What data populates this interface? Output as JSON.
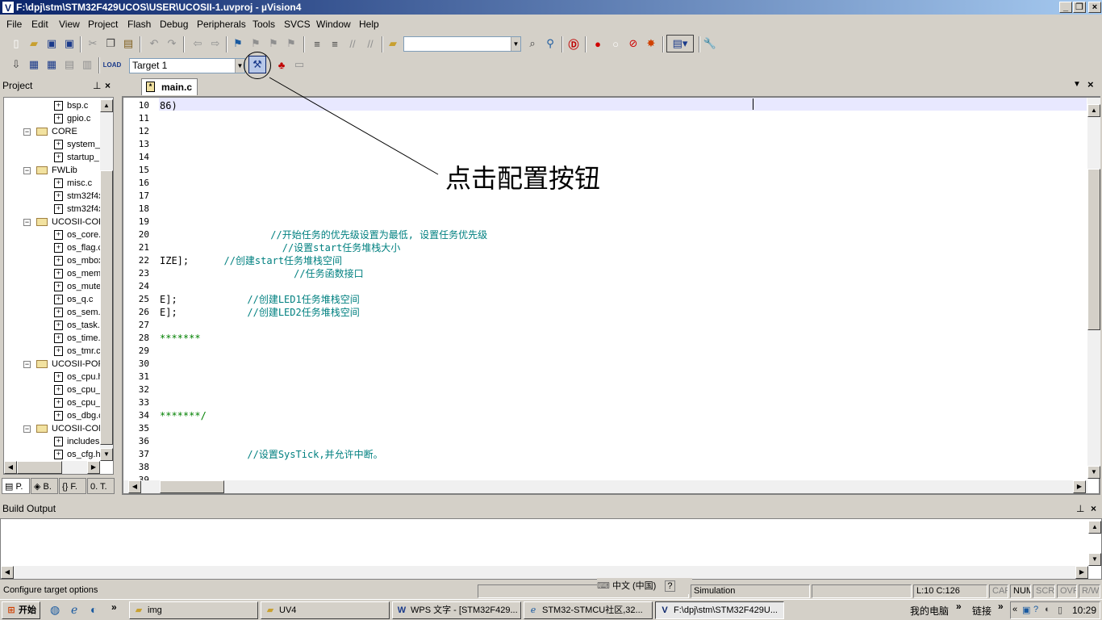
{
  "window": {
    "title": "F:\\dpj\\stm\\STM32F429UCOS\\USER\\UCOSII-1.uvproj - µVision4"
  },
  "menu": [
    "File",
    "Edit",
    "View",
    "Project",
    "Flash",
    "Debug",
    "Peripherals",
    "Tools",
    "SVCS",
    "Window",
    "Help"
  ],
  "toolbar": {
    "target": "Target 1",
    "find_value": ""
  },
  "project": {
    "header": "Project",
    "tree": [
      {
        "type": "file",
        "label": "bsp.c",
        "indent": 2
      },
      {
        "type": "file",
        "label": "gpio.c",
        "indent": 2
      },
      {
        "type": "folder",
        "label": "CORE",
        "indent": 1
      },
      {
        "type": "file",
        "label": "system_s",
        "indent": 2
      },
      {
        "type": "file",
        "label": "startup_",
        "indent": 2
      },
      {
        "type": "folder",
        "label": "FWLib",
        "indent": 1
      },
      {
        "type": "file",
        "label": "misc.c",
        "indent": 2
      },
      {
        "type": "file",
        "label": "stm32f4x",
        "indent": 2
      },
      {
        "type": "file",
        "label": "stm32f4x",
        "indent": 2
      },
      {
        "type": "folder",
        "label": "UCOSII-COR",
        "indent": 1
      },
      {
        "type": "file",
        "label": "os_core.",
        "indent": 2
      },
      {
        "type": "file",
        "label": "os_flag.c",
        "indent": 2
      },
      {
        "type": "file",
        "label": "os_mbox",
        "indent": 2
      },
      {
        "type": "file",
        "label": "os_mem.",
        "indent": 2
      },
      {
        "type": "file",
        "label": "os_mute",
        "indent": 2
      },
      {
        "type": "file",
        "label": "os_q.c",
        "indent": 2
      },
      {
        "type": "file",
        "label": "os_sem.c",
        "indent": 2
      },
      {
        "type": "file",
        "label": "os_task.",
        "indent": 2
      },
      {
        "type": "file",
        "label": "os_time.",
        "indent": 2
      },
      {
        "type": "file",
        "label": "os_tmr.c",
        "indent": 2
      },
      {
        "type": "folder",
        "label": "UCOSII-POR",
        "indent": 1
      },
      {
        "type": "file",
        "label": "os_cpu.h",
        "indent": 2
      },
      {
        "type": "file",
        "label": "os_cpu_",
        "indent": 2
      },
      {
        "type": "file",
        "label": "os_cpu_",
        "indent": 2
      },
      {
        "type": "file",
        "label": "os_dbg.c",
        "indent": 2
      },
      {
        "type": "folder",
        "label": "UCOSII-CON",
        "indent": 1
      },
      {
        "type": "file",
        "label": "includes.",
        "indent": 2
      },
      {
        "type": "file",
        "label": "os_cfg.h",
        "indent": 2
      }
    ],
    "tabs": [
      "P.",
      "B.",
      "F.",
      "T."
    ]
  },
  "editor": {
    "tab": "main.c",
    "lines": [
      {
        "n": "10",
        "code": "86)",
        "cls": ""
      },
      {
        "n": "11",
        "code": "",
        "cls": ""
      },
      {
        "n": "12",
        "code": "",
        "cls": ""
      },
      {
        "n": "13",
        "code": "",
        "cls": ""
      },
      {
        "n": "14",
        "code": "",
        "cls": ""
      },
      {
        "n": "15",
        "code": "",
        "cls": ""
      },
      {
        "n": "16",
        "code": "",
        "cls": ""
      },
      {
        "n": "17",
        "code": "",
        "cls": ""
      },
      {
        "n": "18",
        "code": "",
        "cls": ""
      },
      {
        "n": "19",
        "code": "",
        "cls": ""
      },
      {
        "n": "20",
        "code": "                   //开始任务的优先级设置为最低, 设置任务优先级",
        "cls": "cmt"
      },
      {
        "n": "21",
        "code": "                     //设置start任务堆栈大小",
        "cls": "cmt"
      },
      {
        "n": "22",
        "code": "IZE];      //创建start任务堆栈空间",
        "cls": "mixed"
      },
      {
        "n": "23",
        "code": "                       //任务函数接口",
        "cls": "cmt"
      },
      {
        "n": "24",
        "code": "",
        "cls": ""
      },
      {
        "n": "25",
        "code": "E];            //创建LED1任务堆栈空间",
        "cls": "mixed"
      },
      {
        "n": "26",
        "code": "E];            //创建LED2任务堆栈空间",
        "cls": "mixed"
      },
      {
        "n": "27",
        "code": "",
        "cls": ""
      },
      {
        "n": "28",
        "code": "*******",
        "cls": "green"
      },
      {
        "n": "29",
        "code": "",
        "cls": ""
      },
      {
        "n": "30",
        "code": "",
        "cls": ""
      },
      {
        "n": "31",
        "code": "",
        "cls": ""
      },
      {
        "n": "32",
        "code": "",
        "cls": ""
      },
      {
        "n": "33",
        "code": "",
        "cls": ""
      },
      {
        "n": "34",
        "code": "*******/",
        "cls": "green"
      },
      {
        "n": "35",
        "code": "",
        "cls": ""
      },
      {
        "n": "36",
        "code": "",
        "cls": ""
      },
      {
        "n": "37",
        "code": "               //设置SysTick,并允许中断。",
        "cls": "cmt"
      },
      {
        "n": "38",
        "code": "",
        "cls": ""
      },
      {
        "n": "39",
        "code": "",
        "cls": ""
      }
    ]
  },
  "annotation": {
    "text": "点击配置按钮"
  },
  "build": {
    "header": "Build Output"
  },
  "status": {
    "message": "Configure target options",
    "ime": "中文 (中国)",
    "mode": "Simulation",
    "position": "L:10 C:126",
    "caps": "CAP",
    "num": "NUM",
    "scrl": "SCRL",
    "ovr": "OVR",
    "rw": "R/W"
  },
  "taskbar": {
    "start": "开始",
    "tasks": [
      "img",
      "UV4",
      "WPS 文字 - [STM32F429...",
      "STM32-STMCU社区,32...",
      "F:\\dpj\\stm\\STM32F429U..."
    ],
    "tray_label": "我的电脑",
    "link_label": "链接",
    "clock": "10:29"
  }
}
